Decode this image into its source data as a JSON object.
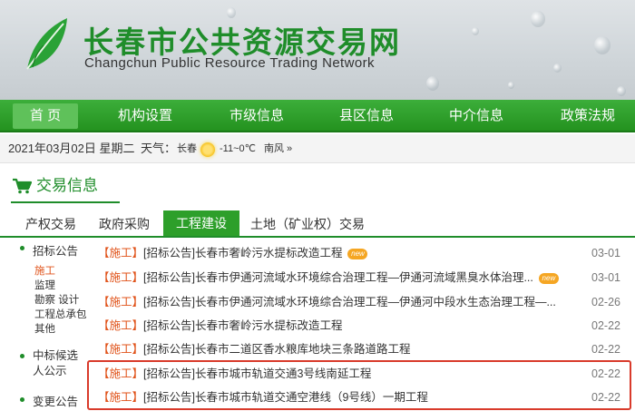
{
  "header": {
    "title": "长春市公共资源交易网",
    "subtitle": "Changchun Public Resource Trading Network"
  },
  "nav": {
    "items": [
      "首 页",
      "机构设置",
      "市级信息",
      "县区信息",
      "中介信息",
      "政策法规"
    ],
    "active_index": 0
  },
  "infobar": {
    "date": "2021年03月02日 星期二",
    "weather_label": "天气：",
    "city": "长春",
    "temp": "-11~0℃",
    "wind": "南风 »"
  },
  "section": {
    "title": "交易信息"
  },
  "tabs": {
    "items": [
      "产权交易",
      "政府采购",
      "工程建设",
      "土地（矿业权）交易"
    ],
    "active_index": 2
  },
  "sidebar": {
    "categories": [
      {
        "label": "招标公告",
        "subs": [
          "施工",
          "监理",
          "勘察 设计",
          "工程总承包",
          "其他"
        ],
        "active_sub": "施工"
      },
      {
        "label": "中标候选人公示"
      },
      {
        "label": "变更公告"
      }
    ]
  },
  "list": {
    "new_badge": "new",
    "rows": [
      {
        "tag": "【施工】",
        "text": "[招标公告]长春市奢岭污水提标改造工程",
        "date": "03-01",
        "new": true
      },
      {
        "tag": "【施工】",
        "text": "[招标公告]长春市伊通河流域水环境综合治理工程—伊通河流域黑臭水体治理...",
        "date": "03-01",
        "new": true
      },
      {
        "tag": "【施工】",
        "text": "[招标公告]长春市伊通河流域水环境综合治理工程—伊通河中段水生态治理工程—...",
        "date": "02-26",
        "new": false
      },
      {
        "tag": "【施工】",
        "text": "[招标公告]长春市奢岭污水提标改造工程",
        "date": "02-22",
        "new": false
      },
      {
        "tag": "【施工】",
        "text": "[招标公告]长春市二道区香水粮库地块三条路道路工程",
        "date": "02-22",
        "new": false
      },
      {
        "tag": "【施工】",
        "text": "[招标公告]长春市城市轨道交通3号线南延工程",
        "date": "02-22",
        "new": false
      },
      {
        "tag": "【施工】",
        "text": "[招标公告]长春市城市轨道交通空港线（9号线）一期工程",
        "date": "02-22",
        "new": false
      }
    ]
  }
}
